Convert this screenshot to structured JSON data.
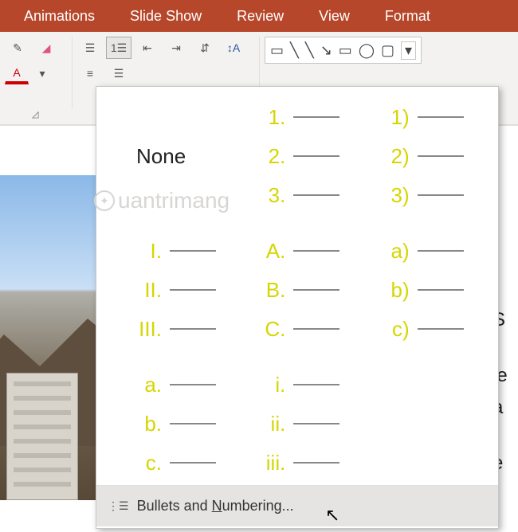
{
  "tabs": {
    "animations": "Animations",
    "slide_show": "Slide Show",
    "review": "Review",
    "view": "View",
    "format": "Format"
  },
  "dropdown": {
    "none": "None",
    "opt_arabic_dot": [
      "1.",
      "2.",
      "3."
    ],
    "opt_arabic_paren": [
      "1)",
      "2)",
      "3)"
    ],
    "opt_roman_upper": [
      "I.",
      "II.",
      "III."
    ],
    "opt_alpha_upper": [
      "A.",
      "B.",
      "C."
    ],
    "opt_alpha_lower_paren": [
      "a)",
      "b)",
      "c)"
    ],
    "opt_alpha_lower_dot": [
      "a.",
      "b.",
      "c."
    ],
    "opt_roman_lower": [
      "i.",
      "ii.",
      "iii."
    ],
    "footer_prefix": "Bullets and ",
    "footer_under": "N",
    "footer_suffix": "umbering..."
  },
  "watermark": {
    "text": "uantrimang"
  },
  "side": {
    "c1": "(",
    "c2": "S",
    "c3": "le",
    "c4": "a",
    "c5": "e"
  }
}
